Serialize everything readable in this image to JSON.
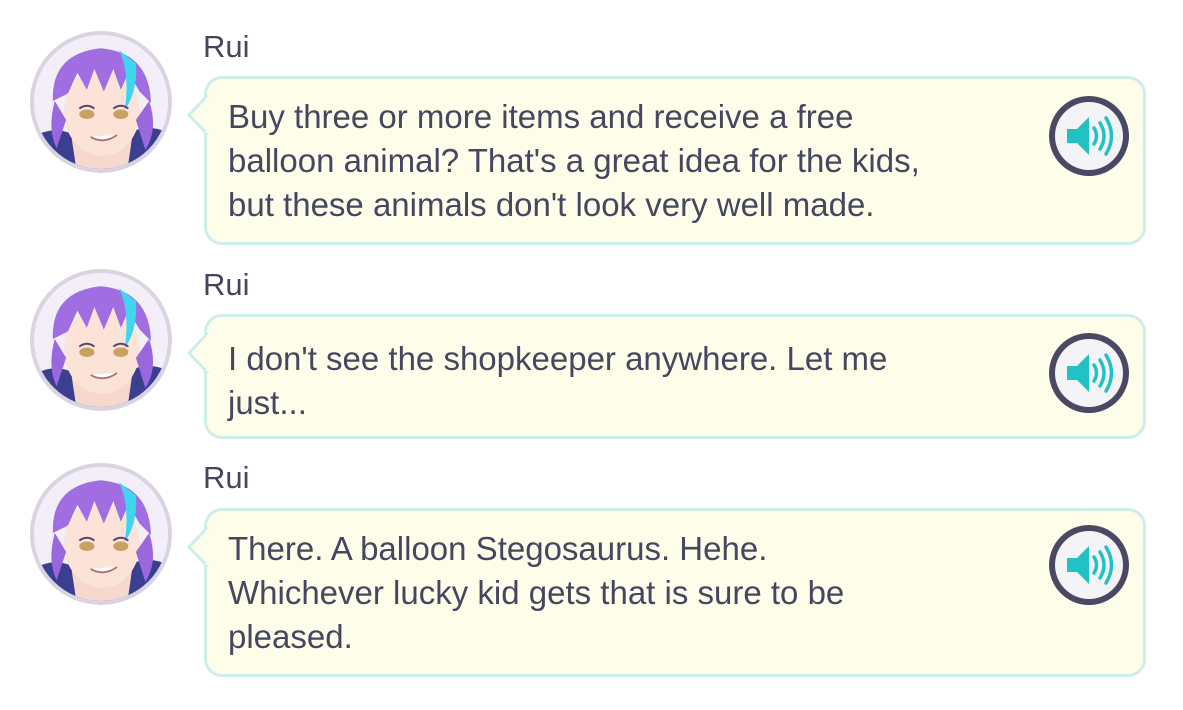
{
  "messages": [
    {
      "speaker": "Rui",
      "text": "Buy three or more items and receive a free\nballoon animal? That's a great idea for the kids,\nbut these animals don't look very well made.",
      "avatar_icon": "rui-avatar",
      "voice_icon": "speaker-icon"
    },
    {
      "speaker": "Rui",
      "text": "I don't see the shopkeeper anywhere. Let me\njust...",
      "avatar_icon": "rui-avatar",
      "voice_icon": "speaker-icon"
    },
    {
      "speaker": "Rui",
      "text": "There. A balloon Stegosaurus. Hehe.\nWhichever lucky kid gets that is sure to be\npleased.",
      "avatar_icon": "rui-avatar",
      "voice_icon": "speaker-icon"
    }
  ],
  "colors": {
    "bubble_fill": "#fdfdea",
    "bubble_border": "#cdeee9",
    "text": "#454660",
    "voice_button_ring": "#4a4862",
    "voice_icon_teal": "#22c2c4",
    "hair_purple": "#a06ee0",
    "hair_streak": "#3fd6f0"
  }
}
